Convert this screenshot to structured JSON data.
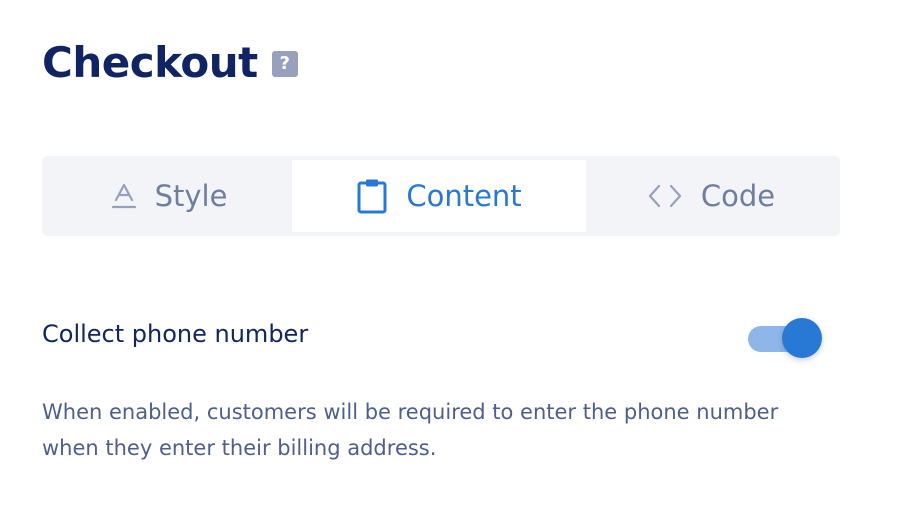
{
  "header": {
    "title": "Checkout",
    "help_icon": "?"
  },
  "tabs": [
    {
      "label": "Style",
      "icon": "text-style-icon",
      "selected": false
    },
    {
      "label": "Content",
      "icon": "clipboard-icon",
      "selected": true
    },
    {
      "label": "Code",
      "icon": "code-brackets-icon",
      "selected": false
    }
  ],
  "setting": {
    "label": "Collect phone number",
    "enabled": true,
    "description": "When enabled, customers will be required to enter the phone number when they enter their billing address."
  },
  "colors": {
    "title": "#102463",
    "accent": "#2878d6",
    "tab_inactive": "#6f7d9f",
    "tab_bar_bg": "#f2f4f8",
    "description": "#4e5f8c"
  }
}
